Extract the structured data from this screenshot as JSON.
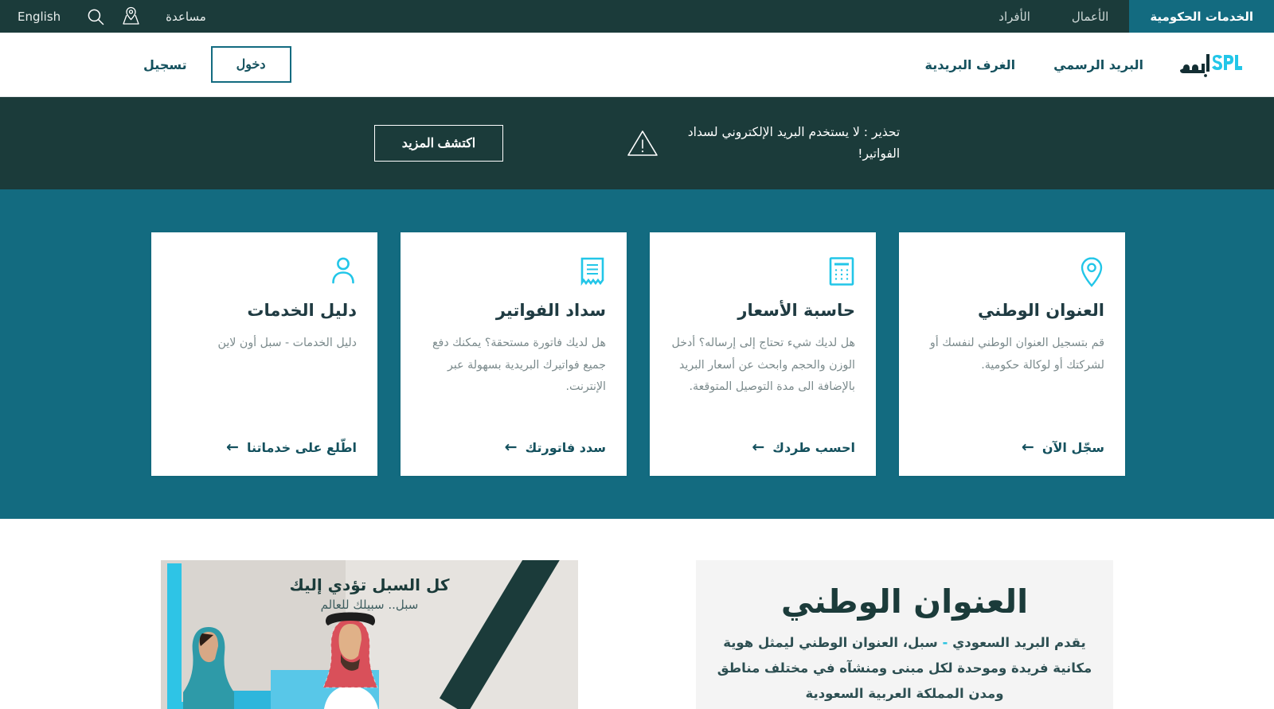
{
  "topbar": {
    "tabs": [
      {
        "label": "الخدمات الحكومية",
        "active": true
      },
      {
        "label": "الأعمال",
        "active": false
      },
      {
        "label": "الأفراد",
        "active": false
      }
    ],
    "help_label": "مساعدة",
    "locator_icon": "map-pin-icon",
    "search_icon": "search-icon",
    "language_label": "English",
    "active_tab_color": "#136B80",
    "background_color": "#1B3B3A"
  },
  "mainnav": {
    "logo_latin": "SPL",
    "logo_arabic": "سبل",
    "items": [
      {
        "label": "البريد الرسمي"
      },
      {
        "label": "الغرف البريدية"
      }
    ],
    "login_label": "دخول",
    "register_label": "تسجيل",
    "accent_color": "#136B80"
  },
  "warning": {
    "icon": "warning-triangle-icon",
    "text": "تحذير : لا يستخدم البريد الإلكتروني لسداد الفواتير!",
    "button_label": "اكتشف المزيد",
    "background_color": "#1B3B3A"
  },
  "cards_section": {
    "background_color": "#136B80",
    "cards": [
      {
        "icon": "location-pin-icon",
        "title": "العنوان الوطني",
        "description": "قم بتسجيل العنوان الوطني لنفسك أو لشركتك أو لوكالة حكومية.",
        "link_label": "سجّل الآن",
        "arrow": "←"
      },
      {
        "icon": "calculator-icon",
        "title": "حاسبة الأسعار",
        "description": "هل لديك شيء تحتاج إلى إرساله؟ أدخل الوزن والحجم وابحث عن أسعار البريد بالإضافة الى مدة التوصيل المتوقعة.",
        "link_label": "احسب طردك",
        "arrow": "←"
      },
      {
        "icon": "invoice-receipt-icon",
        "title": "سداد الفواتير",
        "description": "هل لديك فاتورة مستحقة؟ يمكنك دفع جميع فواتيرك البريدية بسهولة عبر الإنترنت.",
        "link_label": "سدد فاتورتك",
        "arrow": "←"
      },
      {
        "icon": "person-icon",
        "title": "دليل الخدمات",
        "description": "دليل الخدمات - سبل أون لاين",
        "link_label": "اطّلع على خدماتنا",
        "arrow": "←"
      }
    ]
  },
  "lower": {
    "national_address": {
      "title": "العنوان الوطني",
      "body_prefix": "يقدم البريد السعودي ",
      "body_accent": "-",
      "body_rest": " سبل، العنوان الوطني ليمثل هوية مكانية فريدة وموحدة لكل مبنى ومنشآه في مختلف مناطق ومدن المملكة العربية السعودية"
    },
    "promo": {
      "headline": "كل السبل تؤدي إليك",
      "subline": "سبل.. سبيلك للعالم"
    }
  }
}
